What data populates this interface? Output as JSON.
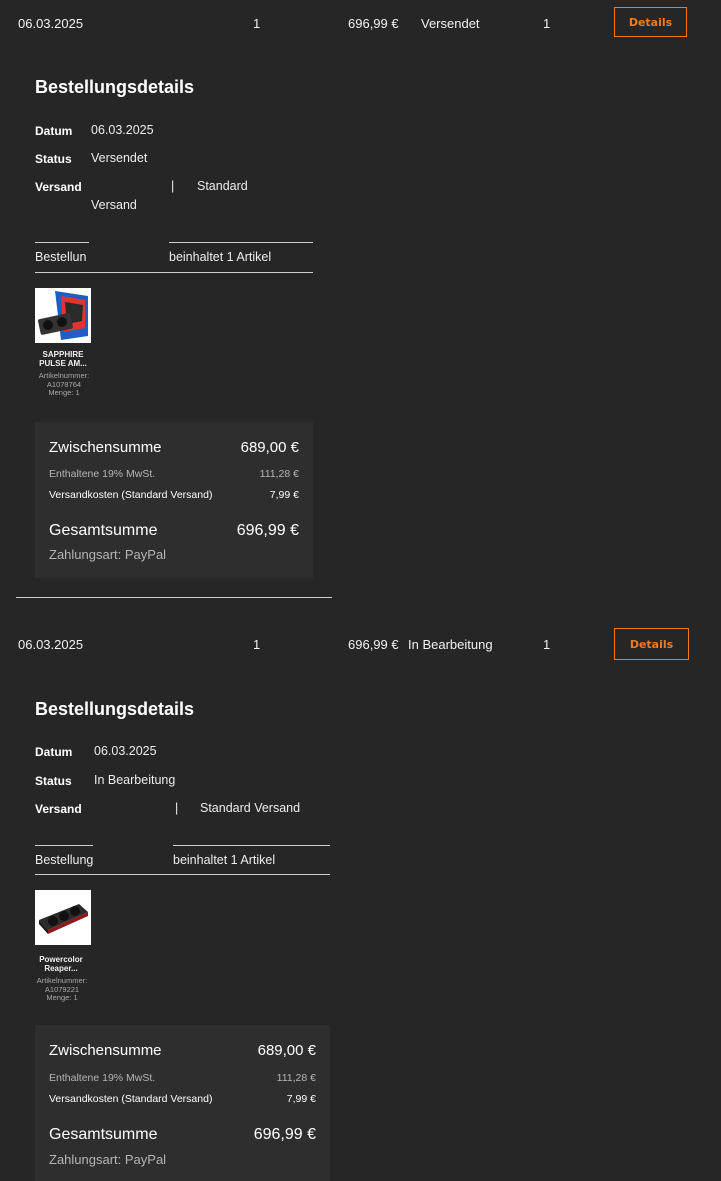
{
  "orders": [
    {
      "row": {
        "date": "06.03.2025",
        "count": "1",
        "total": "696,99 €",
        "status": "Versendet",
        "qty": "1",
        "details_label": "Details"
      },
      "details": {
        "title": "Bestellungsdetails",
        "date_label": "Datum",
        "date_value": "06.03.2025",
        "status_label": "Status",
        "status_value": "Versendet",
        "shipping_label": "Versand",
        "shipping_sep": "|",
        "shipping_value_1": "Standard",
        "shipping_value_2": "Versand",
        "items_left": "Bestellun",
        "items_right": "beinhaltet 1 Artikel",
        "product": {
          "name": "SAPPHIRE PULSE AM...",
          "sku_label": "Artikelnummer:",
          "sku": "A1078764",
          "qty": "Menge: 1"
        },
        "summary": {
          "subtotal_label": "Zwischensumme",
          "subtotal": "689,00 €",
          "vat_label": "Enthaltene 19% MwSt.",
          "vat": "111,28 €",
          "shipping_cost_label": "Versandkosten (Standard Versand)",
          "shipping_cost": "7,99 €",
          "total_label": "Gesamtsumme",
          "total": "696,99 €",
          "payment": "Zahlungsart: PayPal"
        }
      }
    },
    {
      "row": {
        "date": "06.03.2025",
        "count": "1",
        "total": "696,99 €",
        "status": "In Bearbeitung",
        "qty": "1",
        "details_label": "Details"
      },
      "details": {
        "title": "Bestellungsdetails",
        "date_label": "Datum",
        "date_value": "06.03.2025",
        "status_label": "Status",
        "status_value": "In Bearbeitung",
        "shipping_label": "Versand",
        "shipping_sep": "|",
        "shipping_value": "Standard Versand",
        "items_left": "Bestellung",
        "items_right": "beinhaltet 1 Artikel",
        "product": {
          "name": "Powercolor Reaper...",
          "sku_label": "Artikelnummer:",
          "sku": "A1079221",
          "qty": "Menge: 1"
        },
        "summary": {
          "subtotal_label": "Zwischensumme",
          "subtotal": "689,00 €",
          "vat_label": "Enthaltene 19% MwSt.",
          "vat": "111,28 €",
          "shipping_cost_label": "Versandkosten (Standard Versand)",
          "shipping_cost": "7,99 €",
          "total_label": "Gesamtsumme",
          "total": "696,99 €",
          "payment": "Zahlungsart: PayPal"
        }
      }
    }
  ],
  "colors": {
    "background": "#262626",
    "accent": "#f07a1e",
    "summary_box": "#2e2e2e"
  },
  "icons": {
    "product_1": "graphics-card-boxed-image",
    "product_2": "graphics-card-image"
  }
}
